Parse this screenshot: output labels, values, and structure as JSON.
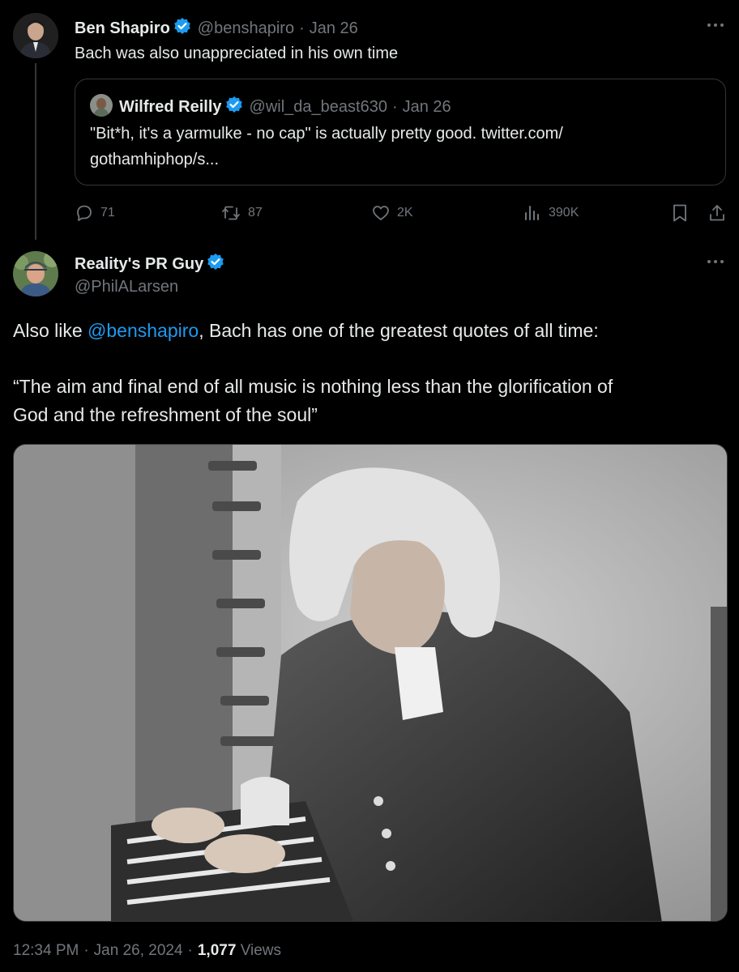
{
  "parent_tweet": {
    "author_name": "Ben Shapiro",
    "handle": "@benshapiro",
    "separator": "·",
    "date": "Jan 26",
    "text": "Bach was also unappreciated in his own time",
    "quoted": {
      "author_name": "Wilfred Reilly",
      "handle": "@wil_da_beast630",
      "separator": "·",
      "date": "Jan 26",
      "text_line1": "\"Bit*h, it's a yarmulke - no cap\" is actually pretty good. twitter.com/",
      "text_line2": "gothamhiphop/s..."
    },
    "stats": {
      "replies": "71",
      "retweets": "87",
      "likes": "2K",
      "views": "390K"
    }
  },
  "main_tweet": {
    "author_name": "Reality's PR Guy",
    "handle": "@PhilALarsen",
    "text_before_mention": "Also like ",
    "mention": "@benshapiro",
    "text_after_mention": ", Bach has one of the greatest quotes of all time:",
    "quote_line1": "“The aim and final end of all music is nothing less than the glorification of",
    "quote_line2": "God and the refreshment of the soul”",
    "image_alt": "Engraving portrait of Johann Sebastian Bach at an organ keyboard",
    "time": "12:34 PM",
    "separator": "·",
    "date": "Jan 26, 2024",
    "separator2": "·",
    "views_count": "1,077",
    "views_label": "Views"
  },
  "colors": {
    "background": "#000000",
    "text": "#e7e9ea",
    "muted": "#71767b",
    "link": "#1d9bf0",
    "verified": "#1d9bf0"
  },
  "icons": [
    "more-icon",
    "verified-icon",
    "reply-icon",
    "retweet-icon",
    "like-icon",
    "views-icon",
    "bookmark-icon",
    "share-icon"
  ]
}
